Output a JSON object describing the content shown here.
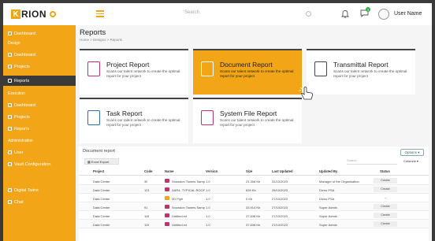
{
  "brand": {
    "logo_letter": "K",
    "logo_text": "RION"
  },
  "header": {
    "search_placeholder": "Search",
    "notification_count": "3",
    "user_name": "User Name"
  },
  "sidebar": {
    "items": [
      {
        "label": "Dashboard",
        "icon": "grid-icon"
      },
      {
        "label": "Design",
        "section": true
      },
      {
        "label": "Dashboard",
        "icon": "gauge-icon"
      },
      {
        "label": "Projects",
        "icon": "file-icon"
      },
      {
        "label": "Reports",
        "icon": "report-icon",
        "active": true
      },
      {
        "label": "Execution",
        "section": true
      },
      {
        "label": "Dashboard",
        "icon": "gauge-icon"
      },
      {
        "label": "Projects",
        "icon": "file-icon"
      },
      {
        "label": "Reports",
        "icon": "report-icon"
      },
      {
        "label": "Administration",
        "section": true
      },
      {
        "label": "User",
        "icon": "user-icon"
      },
      {
        "label": "Vault Configuration",
        "icon": "users-icon"
      },
      {
        "label": "Digital Twins",
        "icon": "cube-icon"
      },
      {
        "label": "Chat",
        "icon": "chat-icon"
      }
    ]
  },
  "page": {
    "title": "Reports",
    "breadcrumb": "Home > Designs > Reports"
  },
  "cards": [
    {
      "title": "Project Report",
      "desc": "Scans our talent network to create the optimal report for your project",
      "icon_color": "#c0336b",
      "highlight": false
    },
    {
      "title": "Document Report",
      "desc": "Scans our talent network to create the optimal report for your project",
      "icon_color": "#ffffff",
      "highlight": true
    },
    {
      "title": "Transmittal Report",
      "desc": "Scans our talent network to create the optimal report for your project",
      "icon_color": "#444444",
      "highlight": false
    },
    {
      "title": "Task Report",
      "desc": "Scans our talent network to create the optimal report for your project",
      "icon_color": "#2e6fa8",
      "highlight": false
    },
    {
      "title": "System File Report",
      "desc": "Scans our talent network to create the optimal report for your project",
      "icon_color": "#c0336b",
      "highlight": false
    }
  ],
  "table": {
    "title": "Document report",
    "options_label": "Options",
    "export_label": "Excel Export",
    "search_placeholder": "Search",
    "columns_label": "Columns",
    "headers": [
      "Project",
      "Code",
      "Name",
      "Version",
      "Size",
      "Last Updated",
      "Updated By",
      "Status"
    ],
    "rows": [
      {
        "project": "Data Center",
        "code": "39",
        "name": "Snowdon Towers Sample H...",
        "version": "1.0",
        "size": "21.308 Kb",
        "updated": "31/10/2023",
        "by": "Manager of the Organisation",
        "status": "Create",
        "icon_color": "#c0336b"
      },
      {
        "project": "Data Center",
        "code": "121",
        "name": "AAR4- TYPICAL ROOF SLAB ...",
        "version": "1.0",
        "size": "839 Kb",
        "updated": "28/10/2023",
        "by": "Divno PSA",
        "status": "Create",
        "icon_color": "#c0336b"
      },
      {
        "project": "Data Center",
        "code": "",
        "name": "3D Pipe",
        "version": "1.0",
        "size": "0 Kb",
        "updated": "27/10/2023",
        "by": "Divno PSA",
        "status": "--",
        "icon_color": "#f2a516"
      },
      {
        "project": "Data Center",
        "code": "91",
        "name": "Snowdon Towers Sample Pl...",
        "version": "1.0",
        "size": "33.914 Kb",
        "updated": "27/10/2023",
        "by": "Super Admin",
        "status": "Create",
        "icon_color": "#c0336b"
      },
      {
        "project": "Data Center",
        "code": "118",
        "name": "Untitled.rvt",
        "version": "1.0",
        "size": "37.836 Kb",
        "updated": "27/10/2023",
        "by": "Super Admin",
        "status": "Create",
        "icon_color": "#c0336b"
      },
      {
        "project": "Data Center",
        "code": "119",
        "name": "Untitled.rvt",
        "version": "1.0",
        "size": "37.836 Kb",
        "updated": "27/10/2023",
        "by": "Super Admin",
        "status": "Create",
        "icon_color": "#c0336b"
      }
    ]
  },
  "colors": {
    "accent": "#f2a516",
    "dark": "#3a3a3a"
  }
}
